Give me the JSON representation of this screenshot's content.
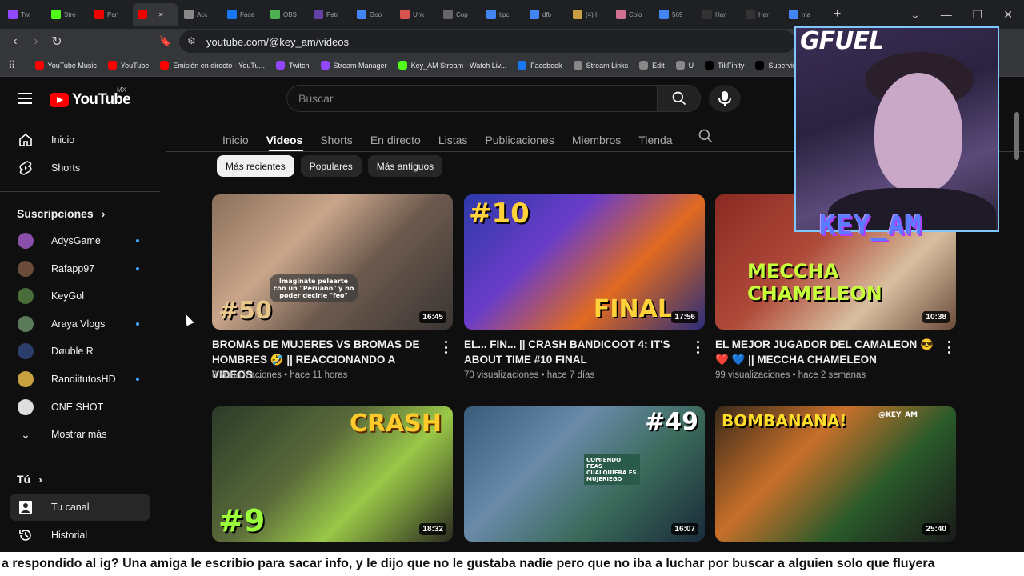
{
  "browser": {
    "tabs": [
      "Twi",
      "Stre",
      "Pan",
      "",
      "Acc",
      "Face",
      "OBS",
      "Patr",
      "Goo",
      "Unk",
      "Cop",
      "tipc",
      "dfb",
      "(4) I",
      "Colo",
      "569",
      "Har",
      "Har",
      "ma"
    ],
    "url": "youtube.com/@key_am/videos",
    "bookmarks": [
      "YouTube Music",
      "YouTube",
      "Emisión en directo - YouTu...",
      "Twitch",
      "Stream Manager",
      "Key_AM Stream - Watch Liv...",
      "Facebook",
      "Stream Links",
      "Edit",
      "U",
      "TikFinity",
      "Supervisión del Li"
    ]
  },
  "header": {
    "logo_text": "YouTube",
    "region": "MX",
    "search_placeholder": "Buscar"
  },
  "sidebar": {
    "main": [
      {
        "label": "Inicio",
        "icon": "home-icon"
      },
      {
        "label": "Shorts",
        "icon": "shorts-icon"
      }
    ],
    "subscriptions_title": "Suscripciones",
    "subscriptions": [
      {
        "name": "AdysGame",
        "live": true,
        "color": "#8a4fa8"
      },
      {
        "name": "Rafapp97",
        "live": true,
        "color": "#6b4b3a"
      },
      {
        "name": "KeyGol",
        "live": false,
        "color": "#4a6b3a"
      },
      {
        "name": "Araya Vlogs",
        "live": true,
        "color": "#5a7a5a"
      },
      {
        "name": "Døuble R",
        "live": false,
        "color": "#2c3e6b"
      },
      {
        "name": "RandiitutosHD",
        "live": true,
        "color": "#c8a040"
      },
      {
        "name": "ONE SHOT",
        "live": false,
        "color": "#dddddd"
      }
    ],
    "show_more": "Mostrar más",
    "you_title": "Tú",
    "you_items": [
      {
        "label": "Tu canal",
        "icon": "channel-icon",
        "active": true
      },
      {
        "label": "Historial",
        "icon": "history-icon",
        "active": false
      }
    ]
  },
  "channel": {
    "tabs": [
      "Inicio",
      "Videos",
      "Shorts",
      "En directo",
      "Listas",
      "Publicaciones",
      "Miembros",
      "Tienda"
    ],
    "active_tab": "Videos",
    "chips": [
      "Más recientes",
      "Populares",
      "Más antiguos"
    ],
    "active_chip": "Más recientes"
  },
  "videos": [
    {
      "title": "BROMAS DE MUJERES VS BROMAS DE HOMBRES 🤣 || REACCIONANDO A VIDEOS...",
      "views": "8 visualizaciones",
      "age": "hace 11 horas",
      "duration": "16:45",
      "overlay": "#50",
      "caption": "Imaginate pelearte con un \"Peruano\" y no poder decirle \"feo\""
    },
    {
      "title": "EL... FIN... || CRASH BANDICOOT 4: IT'S ABOUT TIME #10 FINAL",
      "views": "70 visualizaciones",
      "age": "hace 7 días",
      "duration": "17:56",
      "overlay": "#10",
      "caption": "FINAL"
    },
    {
      "title": "EL MEJOR JUGADOR DEL CAMALEON 😎 ❤️ 💙 || MECCHA CHAMELEON",
      "views": "99 visualizaciones",
      "age": "hace 2 semanas",
      "duration": "10:38",
      "overlay": "MECCHA CHAMELEON",
      "caption": ""
    },
    {
      "title": "",
      "views": "",
      "age": "",
      "duration": "18:32",
      "overlay": "#9",
      "caption": "CRASH"
    },
    {
      "title": "",
      "views": "",
      "age": "",
      "duration": "16:07",
      "overlay": "#49",
      "caption": "COMIENDO FEAS CUALQUIERA ES MUJERIEGO"
    },
    {
      "title": "",
      "views": "",
      "age": "",
      "duration": "25:40",
      "overlay": "BOMBANANA!",
      "caption": "@KEY_AM"
    }
  ],
  "overlay": {
    "sponsor": "GFUEL",
    "streamer": "KEY_AM"
  },
  "subtitle": "a respondido al ig? Una amiga le escribio para sacar info, y le dijo que no le gustaba nadie pero que no iba a luchar por buscar a alguien solo que fluyera"
}
